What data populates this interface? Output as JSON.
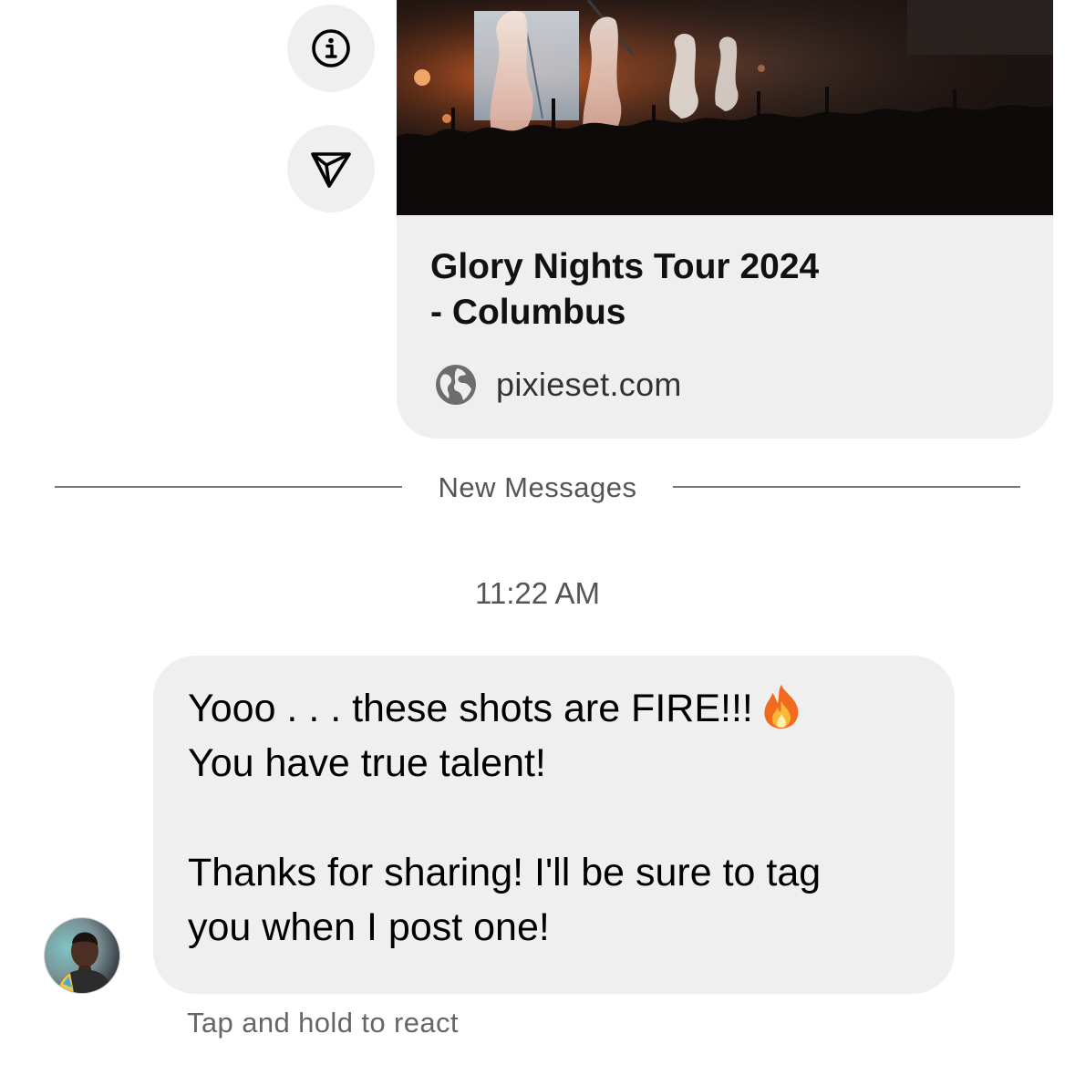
{
  "actions": {
    "info_icon": "info-icon",
    "share_icon": "send-icon"
  },
  "link_preview": {
    "image": "concert-crowd-photo",
    "title_line1": "Glory Nights Tour 2024",
    "title_line2": "- Columbus",
    "domain_icon": "globe-icon",
    "domain": "pixieset.com"
  },
  "divider": {
    "label": "New Messages"
  },
  "timestamp": "11:22 AM",
  "message": {
    "line1": "Yooo . . . these shots are FIRE!!!",
    "emoji": "fire-emoji",
    "line2": "You have true talent!",
    "line3": "Thanks for sharing! I'll be sure to tag",
    "line4": "you when I post one!",
    "hint": "Tap and hold to react"
  },
  "colors": {
    "bubble_bg": "#efefef",
    "divider": "#767676",
    "secondary_text": "#555555"
  }
}
